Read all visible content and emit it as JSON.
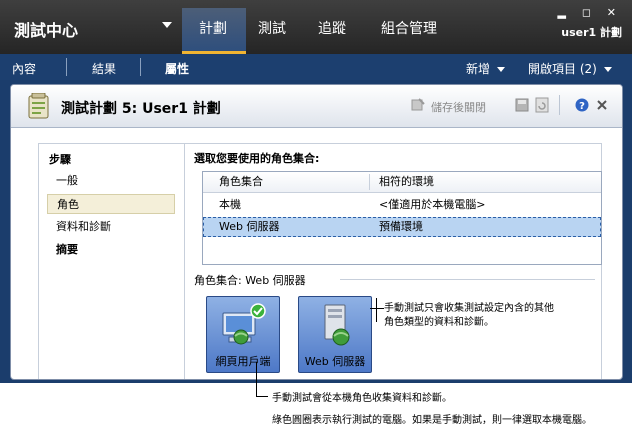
{
  "topbar": {
    "brand": "測試中心",
    "tabs": [
      "計劃",
      "測試",
      "追蹤",
      "組合管理"
    ],
    "active_tab": "計劃",
    "window_controls": "▂ ◻ ✕",
    "user": "user1 計劃"
  },
  "subnav": {
    "items": [
      "內容",
      "結果",
      "屬性"
    ],
    "active": "屬性",
    "new_label": "新增",
    "open_items_label": "開啟項目 (2)"
  },
  "panel": {
    "title": "測試計劃 5: User1 計劃",
    "save_close": "儲存後關閉"
  },
  "steps": {
    "header": "步驟",
    "items": [
      "一般",
      "角色",
      "資料和診斷",
      "摘要"
    ],
    "selected": "角色"
  },
  "roles": {
    "prompt": "選取您要使用的角色集合:",
    "columns": [
      "角色集合",
      "相符的環境"
    ],
    "rows": [
      {
        "name": "本機",
        "env": "<僅適用於本機電腦>"
      },
      {
        "name": "Web 伺服器",
        "env": "預備環境"
      }
    ],
    "selected_row": "Web 伺服器",
    "set_label": "角色集合: Web 伺服器",
    "tiles": [
      "網頁用戶端",
      "Web 伺服器"
    ]
  },
  "callouts": {
    "right_line1": "手動測試只會收集測試設定內含的其他",
    "right_line2": "角色類型的資料和診斷。",
    "bottom1": "手動測試會從本機角色收集資料和診斷。",
    "bottom2": "綠色圓圈表示執行測試的電腦。如果是手動測試，則一律選取本機電腦。"
  }
}
